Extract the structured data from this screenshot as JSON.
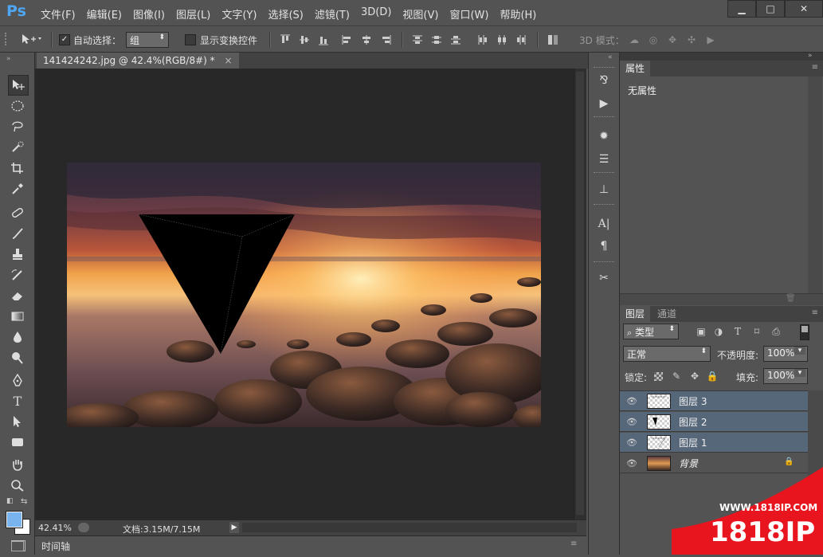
{
  "app": {
    "logo": "Ps"
  },
  "menu": [
    "文件(F)",
    "编辑(E)",
    "图像(I)",
    "图层(L)",
    "文字(Y)",
    "选择(S)",
    "滤镜(T)",
    "3D(D)",
    "视图(V)",
    "窗口(W)",
    "帮助(H)"
  ],
  "window_controls": {
    "minimize": "▁",
    "maximize": "□",
    "close": "✕"
  },
  "options": {
    "auto_select_label": "自动选择：",
    "auto_select_checked": true,
    "auto_select_value": "组",
    "show_transform_label": "显示变换控件",
    "mode_3d_label": "3D 模式："
  },
  "document": {
    "tab_title": "141424242.jpg @ 42.4%(RGB/8#) *",
    "close": "×",
    "zoom": "42.41%",
    "doc_info": "文档:3.15M/7.15M"
  },
  "timeline": {
    "label": "时间轴"
  },
  "properties": {
    "tab": "属性",
    "content": "无属性"
  },
  "layers_panel": {
    "tabs": [
      "图层",
      "通道"
    ],
    "filter_label": "类型",
    "blend_mode": "正常",
    "opacity_label": "不透明度:",
    "opacity_value": "100%",
    "lock_label": "锁定:",
    "fill_label": "填充:",
    "fill_value": "100%",
    "layers": [
      {
        "name": "图层 3",
        "selected": true
      },
      {
        "name": "图层 2",
        "selected": true
      },
      {
        "name": "图层 1",
        "selected": true
      },
      {
        "name": "背景",
        "selected": false,
        "locked": true
      }
    ]
  },
  "watermark": {
    "url": "WWW.1818IP.COM",
    "brand": "1818IP"
  },
  "colors": {
    "accent": "#4ea6f5",
    "selected_layer": "#57677a",
    "watermark_red": "#e8141e"
  }
}
